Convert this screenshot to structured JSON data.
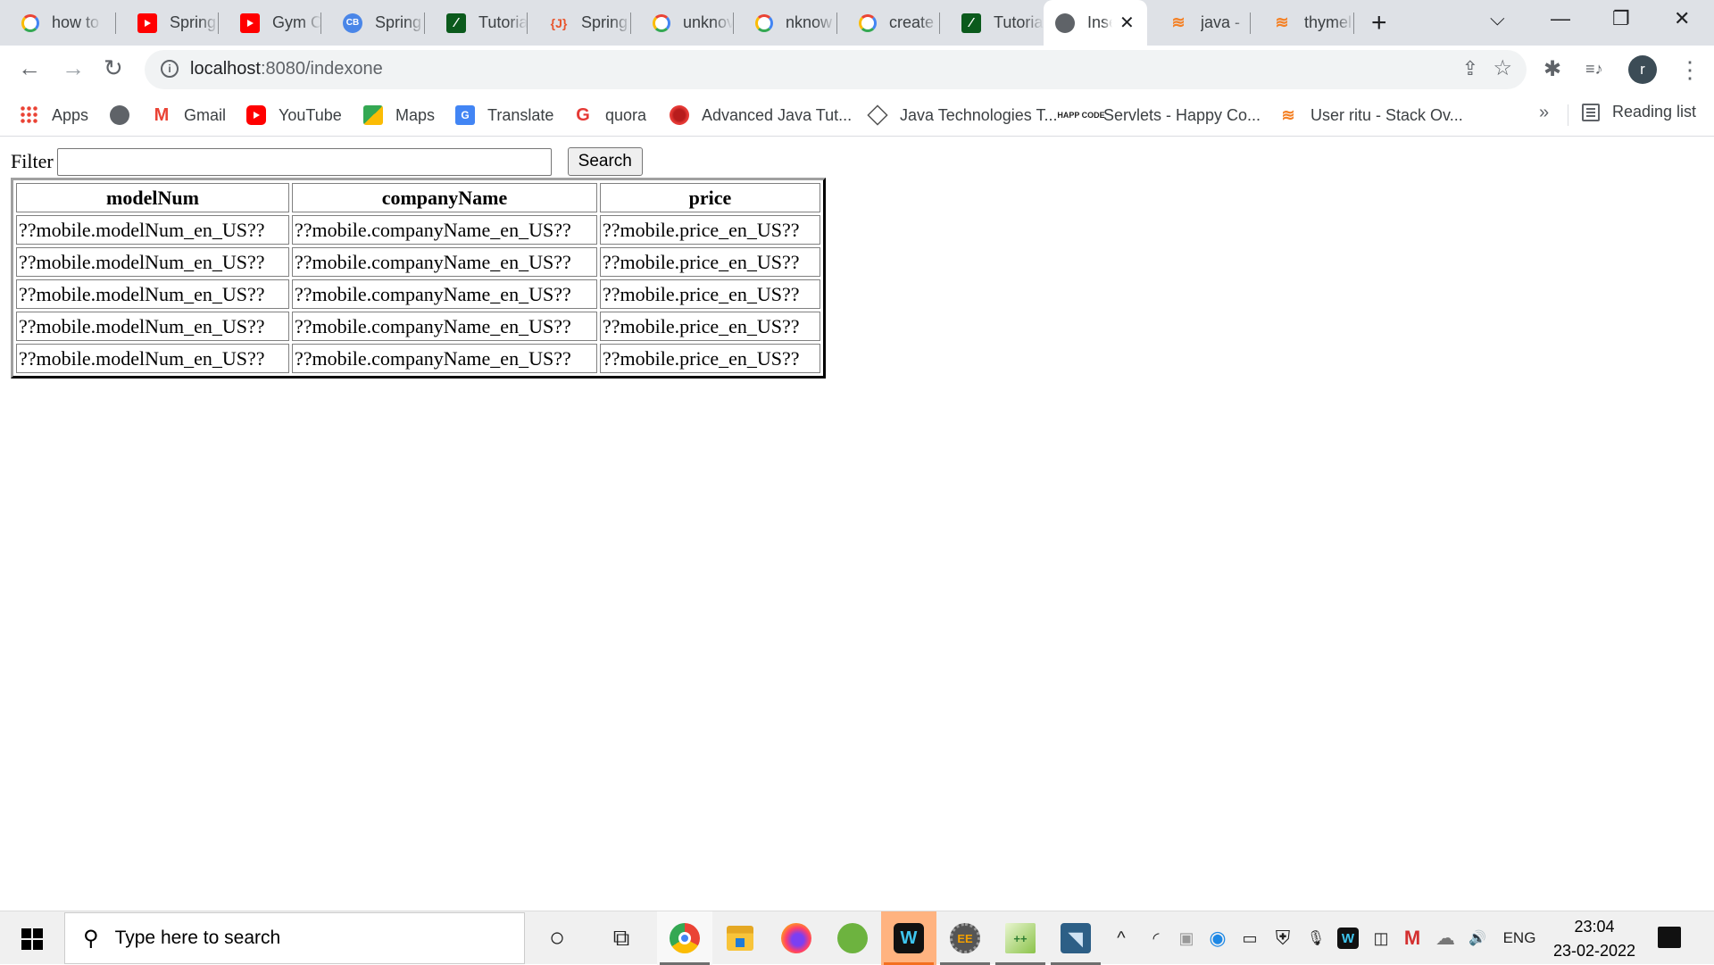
{
  "browser": {
    "tabs": [
      {
        "title": "how to",
        "icon": "google-icon"
      },
      {
        "title": "Spring",
        "icon": "youtube-icon"
      },
      {
        "title": "Gym Cl",
        "icon": "youtube-icon"
      },
      {
        "title": "Spring",
        "icon": "cb-icon"
      },
      {
        "title": "Tutoria",
        "icon": "leaf-icon"
      },
      {
        "title": "Spring",
        "icon": "j-icon"
      },
      {
        "title": "unknov",
        "icon": "google-icon"
      },
      {
        "title": "nknow",
        "icon": "google-icon"
      },
      {
        "title": "create",
        "icon": "google-icon"
      },
      {
        "title": "Tutoria",
        "icon": "leaf-icon"
      },
      {
        "title": "Insert",
        "icon": "globe-icon",
        "active": true
      },
      {
        "title": "java - ",
        "icon": "stackoverflow-icon"
      },
      {
        "title": "thymel",
        "icon": "stackoverflow-icon"
      }
    ],
    "tab_close_glyph": "✕",
    "new_tab_glyph": "+",
    "window_controls": {
      "tab_search": "⌵",
      "minimize": "—",
      "restore": "❐",
      "close": "✕"
    },
    "nav": {
      "back": "←",
      "forward": "→",
      "reload": "↻"
    },
    "address": {
      "host": "localhost",
      "rest": ":8080/indexone",
      "info_glyph": "i"
    },
    "toolbar_icons": {
      "share": "⇪",
      "star": "☆",
      "extensions": "✱",
      "media": "≡♪",
      "menu": "⋮"
    },
    "profile_initial": "r",
    "bookmarks": [
      {
        "label": "Apps",
        "icon": "apps-icon",
        "glyph": ""
      },
      {
        "label": "",
        "icon": "globe-icon",
        "glyph": ""
      },
      {
        "label": "Gmail",
        "icon": "gmail-icon",
        "glyph": "M"
      },
      {
        "label": "YouTube",
        "icon": "youtube-icon",
        "glyph": ""
      },
      {
        "label": "Maps",
        "icon": "maps-icon",
        "glyph": ""
      },
      {
        "label": "Translate",
        "icon": "translate-icon",
        "glyph": "G"
      },
      {
        "label": "quora",
        "icon": "quora-icon",
        "glyph": "G"
      },
      {
        "label": "Advanced Java Tut...",
        "icon": "advanced-java-icon",
        "glyph": ""
      },
      {
        "label": "Java Technologies T...",
        "icon": "java-tech-icon",
        "glyph": ""
      },
      {
        "label": "Servlets - Happy Co...",
        "icon": "happy-code-icon",
        "glyph": "HAPP CODE"
      },
      {
        "label": "User ritu - Stack Ov...",
        "icon": "stackoverflow-icon",
        "glyph": "≋"
      }
    ],
    "bookmarks_more": "»",
    "reading_list": "Reading list"
  },
  "page": {
    "filter_label": "Filter",
    "filter_value": "",
    "search_button": "Search",
    "table": {
      "headers": [
        "modelNum",
        "companyName",
        "price"
      ],
      "rows": [
        [
          "??mobile.modelNum_en_US??",
          "??mobile.companyName_en_US??",
          "??mobile.price_en_US??"
        ],
        [
          "??mobile.modelNum_en_US??",
          "??mobile.companyName_en_US??",
          "??mobile.price_en_US??"
        ],
        [
          "??mobile.modelNum_en_US??",
          "??mobile.companyName_en_US??",
          "??mobile.price_en_US??"
        ],
        [
          "??mobile.modelNum_en_US??",
          "??mobile.companyName_en_US??",
          "??mobile.price_en_US??"
        ],
        [
          "??mobile.modelNum_en_US??",
          "??mobile.companyName_en_US??",
          "??mobile.price_en_US??"
        ]
      ]
    }
  },
  "taskbar": {
    "search_placeholder": "Type here to search",
    "search_glyph": "⚲",
    "cortana_glyph": "○",
    "task_view_glyph": "⧉",
    "apps": [
      {
        "name": "chrome",
        "glyph": "",
        "color": "#4285f4"
      },
      {
        "name": "file-explorer",
        "glyph": "",
        "color": "#f8c43a"
      },
      {
        "name": "firefox",
        "glyph": "",
        "color": "#ff7139"
      },
      {
        "name": "spring-tool-suite",
        "glyph": "",
        "color": "#6db33f"
      },
      {
        "name": "webex",
        "glyph": "W",
        "color": "#1a1a1a"
      },
      {
        "name": "java-ee-ide",
        "glyph": "EE",
        "color": "#555555"
      },
      {
        "name": "notepad-plus-plus",
        "glyph": "++",
        "color": "#8bc34a"
      },
      {
        "name": "mysql-workbench",
        "glyph": "◥",
        "color": "#2d5f86"
      }
    ],
    "tray": [
      {
        "name": "show-hidden-icons",
        "glyph": "^"
      },
      {
        "name": "wifi",
        "glyph": "◜"
      },
      {
        "name": "usb-device",
        "glyph": "▣"
      },
      {
        "name": "cisco-anyconnect",
        "glyph": "◉"
      },
      {
        "name": "battery-saver",
        "glyph": "▭"
      },
      {
        "name": "windows-security",
        "glyph": "⛨"
      },
      {
        "name": "microphone",
        "glyph": "🎙"
      },
      {
        "name": "webex-tray",
        "glyph": "W"
      },
      {
        "name": "camera",
        "glyph": "◫"
      },
      {
        "name": "mcafee",
        "glyph": "M"
      },
      {
        "name": "onedrive",
        "glyph": "☁"
      },
      {
        "name": "volume",
        "glyph": "🔊"
      }
    ],
    "language": "ENG",
    "time": "23:04",
    "date": "23-02-2022"
  }
}
